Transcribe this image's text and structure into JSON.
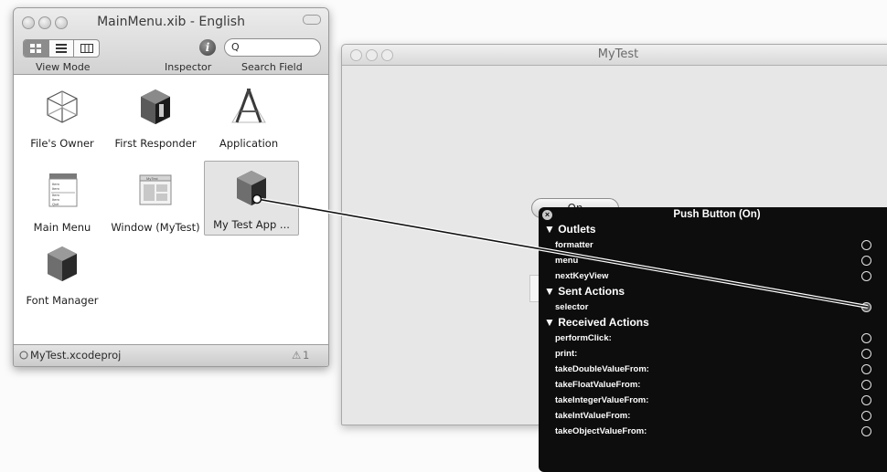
{
  "doc_window": {
    "title": "MainMenu.xib - English",
    "toolbar": {
      "view_mode_label": "View Mode",
      "inspector_label": "Inspector",
      "inspector_glyph": "i",
      "search_field_label": "Search Field",
      "search_glyph": "Q"
    },
    "items": [
      {
        "label": "File's Owner",
        "icon": "wireframe-cube-icon"
      },
      {
        "label": "First Responder",
        "icon": "dark-cube-icon"
      },
      {
        "label": "Application",
        "icon": "application-compass-icon"
      },
      {
        "label": "Main Menu",
        "icon": "menu-icon",
        "menu_lines": [
          "Item",
          "Item",
          "Item",
          "Item",
          "Quit"
        ]
      },
      {
        "label": "Window (MyTest)",
        "icon": "window-icon",
        "window_caption": "MyTest"
      },
      {
        "label": "My Test App ...",
        "icon": "shaded-cube-icon",
        "selected": true
      },
      {
        "label": "Font Manager",
        "icon": "shaded-cube-icon"
      }
    ],
    "status": {
      "project": "MyTest.xcodeproj",
      "count": "1"
    }
  },
  "mytest_window": {
    "title": "MyTest",
    "button_label": "On"
  },
  "hud": {
    "title": "Push Button (On)",
    "sections": [
      {
        "title": "▼ Outlets",
        "rows": [
          "formatter",
          "menu",
          "nextKeyView"
        ]
      },
      {
        "title": "▼ Sent Actions",
        "rows": [
          "selector"
        ]
      },
      {
        "title": "▼ Received Actions",
        "rows": [
          "performClick:",
          "print:",
          "takeDoubleValueFrom:",
          "takeFloatValueFrom:",
          "takeIntegerValueFrom:",
          "takeIntValueFrom:",
          "takeObjectValueFrom:"
        ]
      }
    ],
    "connected_row": "selector"
  }
}
